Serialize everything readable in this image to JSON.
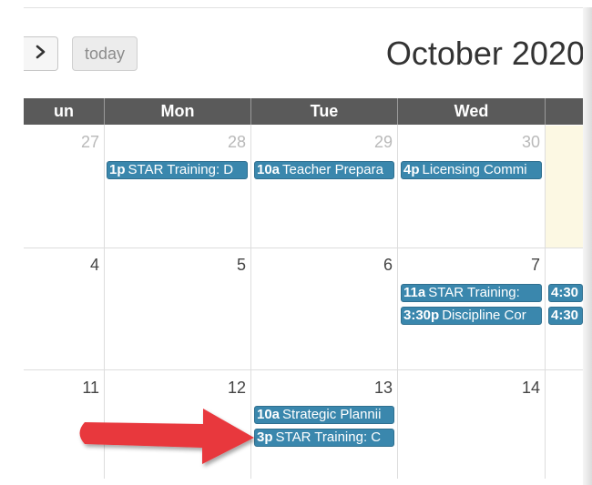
{
  "toolbar": {
    "next_glyph": ">",
    "today_label": "today",
    "title": "October 2020"
  },
  "columns": [
    "un",
    "Mon",
    "Tue",
    "Wed",
    ""
  ],
  "weeks": [
    {
      "days": [
        {
          "num": "27",
          "other": true
        },
        {
          "num": "28",
          "other": true
        },
        {
          "num": "29",
          "other": true
        },
        {
          "num": "30",
          "other": true
        },
        {
          "num": "",
          "other": false
        }
      ],
      "events": [
        {
          "col": 1,
          "time": "1p",
          "title": "STAR Training: D"
        },
        {
          "col": 2,
          "time": "10a",
          "title": "Teacher Prepara"
        },
        {
          "col": 3,
          "time": "4p",
          "title": "Licensing Commi"
        }
      ]
    },
    {
      "days": [
        {
          "num": "4",
          "other": false
        },
        {
          "num": "5",
          "other": false
        },
        {
          "num": "6",
          "other": false
        },
        {
          "num": "7",
          "other": false
        },
        {
          "num": "",
          "other": false
        }
      ],
      "events": [
        {
          "col": 3,
          "time": "11a",
          "title": "STAR Training:"
        },
        {
          "col": 3,
          "time": "3:30p",
          "title": "Discipline Cor"
        },
        {
          "col": 4,
          "time": "4:30",
          "title": ""
        },
        {
          "col": 4,
          "time": "4:30",
          "title": ""
        }
      ]
    },
    {
      "days": [
        {
          "num": "11",
          "other": false
        },
        {
          "num": "12",
          "other": false
        },
        {
          "num": "13",
          "other": false
        },
        {
          "num": "14",
          "other": false
        },
        {
          "num": "",
          "other": false
        }
      ],
      "events": [
        {
          "col": 2,
          "time": "10a",
          "title": "Strategic Plannii"
        },
        {
          "col": 2,
          "time": "3p",
          "title": "STAR Training: C"
        }
      ]
    }
  ],
  "colors": {
    "event_bg": "#3a87ad",
    "header_bg": "#5a5a5a",
    "today_bg": "#fcf8e3",
    "annotation_arrow": "#e8383d"
  }
}
